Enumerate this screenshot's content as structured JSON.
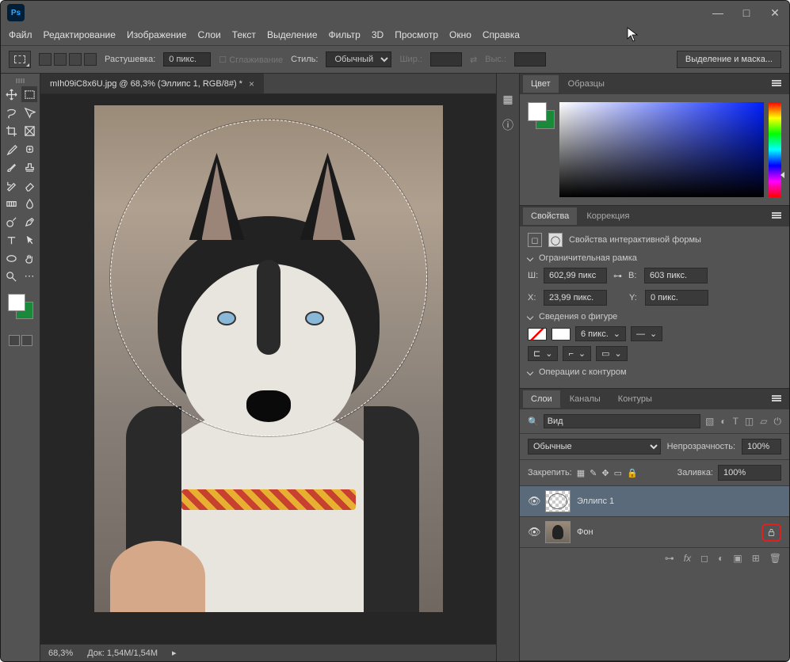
{
  "menubar": [
    "Файл",
    "Редактирование",
    "Изображение",
    "Слои",
    "Текст",
    "Выделение",
    "Фильтр",
    "3D",
    "Просмотр",
    "Окно",
    "Справка"
  ],
  "optionsbar": {
    "feather_label": "Растушевка:",
    "feather_value": "0 пикс.",
    "antialias": "Сглаживание",
    "style_label": "Стиль:",
    "style_value": "Обычный",
    "width_label": "Шир.:",
    "height_label": "Выс.:",
    "select_mask": "Выделение и маска..."
  },
  "doc_tab": "mIh09iC8x6U.jpg @ 68,3% (Эллипс 1, RGB/8#) *",
  "status": {
    "zoom": "68,3%",
    "doc": "Док: 1,54M/1,54M"
  },
  "panel_color": {
    "tabs": [
      "Цвет",
      "Образцы"
    ]
  },
  "panel_props": {
    "tabs": [
      "Свойства",
      "Коррекция"
    ],
    "title": "Свойства интерактивной формы",
    "bbox_section": "Ограничительная рамка",
    "w_label": "Ш:",
    "w_val": "602,99 пикс",
    "h_label": "В:",
    "h_val": "603 пикс.",
    "x_label": "X:",
    "x_val": "23,99 пикс.",
    "y_label": "Y:",
    "y_val": "0 пикс.",
    "shape_section": "Сведения о фигуре",
    "stroke_val": "6 пикс.",
    "ops_section": "Операции с контуром"
  },
  "panel_layers": {
    "tabs": [
      "Слои",
      "Каналы",
      "Контуры"
    ],
    "filter": "Вид",
    "blend": "Обычные",
    "opacity_label": "Непрозрачность:",
    "opacity_val": "100%",
    "lock_label": "Закрепить:",
    "fill_label": "Заливка:",
    "fill_val": "100%",
    "layers": [
      {
        "name": "Эллипс 1"
      },
      {
        "name": "Фон"
      }
    ]
  }
}
